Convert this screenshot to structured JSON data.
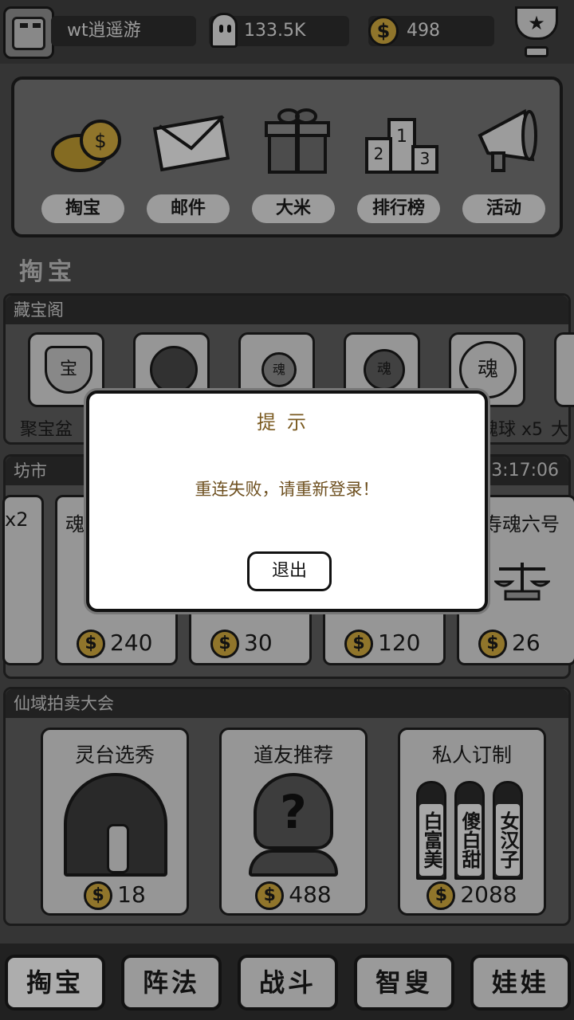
{
  "topbar": {
    "username": "wt逍遥游",
    "spirit_value": "133.5K",
    "coin_value": "498",
    "coin_symbol": "$",
    "trophy_symbol": "★"
  },
  "menu": {
    "items": [
      {
        "label": "掏宝",
        "icon": "coins-icon"
      },
      {
        "label": "邮件",
        "icon": "mail-icon"
      },
      {
        "label": "大米",
        "icon": "gift-icon"
      },
      {
        "label": "排行榜",
        "icon": "podium-icon"
      },
      {
        "label": "活动",
        "icon": "megaphone-icon"
      }
    ]
  },
  "section_title": "掏宝",
  "treasure": {
    "title": "藏宝阁",
    "items": [
      {
        "label": "聚宝盆",
        "glyph": "宝"
      },
      {
        "label": "",
        "glyph": ""
      },
      {
        "label": "",
        "glyph": "魂"
      },
      {
        "label": "",
        "glyph": "魂"
      },
      {
        "label": "魂球 x5",
        "glyph": "魂"
      }
    ],
    "overflow_label": "大"
  },
  "market": {
    "title": "坊市",
    "timer": "3:17:06",
    "cards": [
      {
        "name": "x2",
        "price": ""
      },
      {
        "name": "魂",
        "price": "240"
      },
      {
        "name": "",
        "price": "30"
      },
      {
        "name": "",
        "price": "120"
      },
      {
        "name": "寿魂六号",
        "price": "26"
      }
    ]
  },
  "auction": {
    "title": "仙域拍卖大会",
    "cards": [
      {
        "name": "灵台选秀",
        "price": "18"
      },
      {
        "name": "道友推荐",
        "price": "488",
        "glyph": "?"
      },
      {
        "name": "私人订制",
        "price": "2088",
        "tablets": [
          "白富美",
          "傻白甜",
          "女汉子"
        ]
      }
    ]
  },
  "bottom_nav": [
    {
      "label": "掏宝"
    },
    {
      "label": "阵法"
    },
    {
      "label": "战斗"
    },
    {
      "label": "智叟"
    },
    {
      "label": "娃娃"
    }
  ],
  "dialog": {
    "title": "提示",
    "message": "重连失败，请重新登录！",
    "button": "退出"
  }
}
